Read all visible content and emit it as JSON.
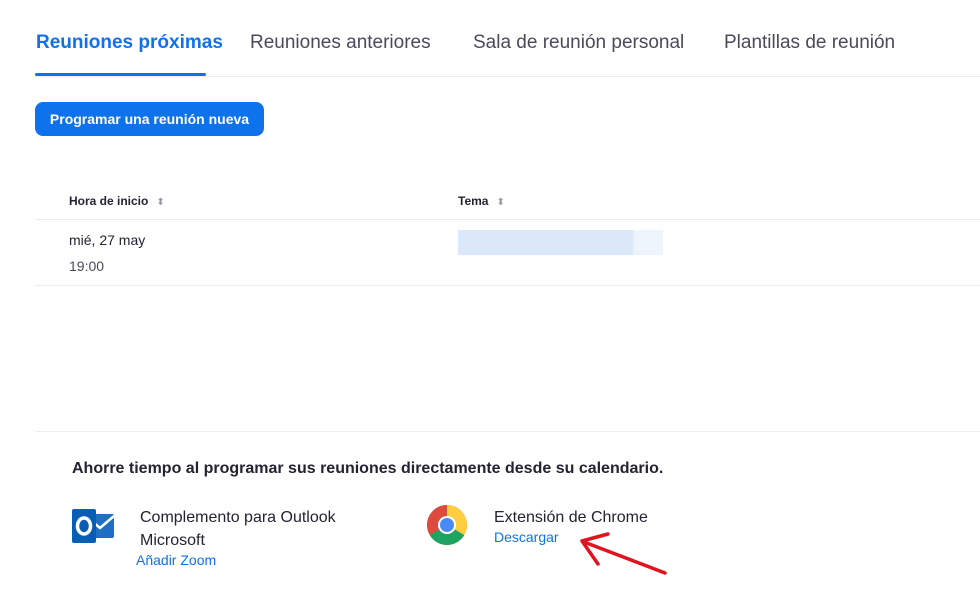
{
  "tabs": [
    {
      "label": "Reuniones próximas",
      "active": true
    },
    {
      "label": "Reuniones anteriores",
      "active": false
    },
    {
      "label": "Sala de reunión personal",
      "active": false
    },
    {
      "label": "Plantillas de reunión",
      "active": false
    }
  ],
  "actions": {
    "schedule_label": "Programar una reunión nueva"
  },
  "table": {
    "columns": [
      {
        "label": "Hora de inicio",
        "sort_icon": "sort-updown-icon"
      },
      {
        "label": "Tema",
        "sort_icon": "sort-updown-icon"
      }
    ],
    "rows": [
      {
        "date": "mié, 27 may",
        "time": "19:00",
        "topic": ""
      }
    ]
  },
  "promo": {
    "title": "Ahorre tiempo al programar sus reuniones directamente desde su calendario.",
    "items": [
      {
        "icon": "outlook-icon",
        "title": "Complemento para Outlook Microsoft",
        "link": "Añadir Zoom"
      },
      {
        "icon": "chrome-icon",
        "title": "Extensión de Chrome",
        "link": "Descargar"
      }
    ]
  },
  "colors": {
    "accent": "#0e72ed",
    "text": "#232333",
    "annotation_arrow": "#e0141e"
  }
}
